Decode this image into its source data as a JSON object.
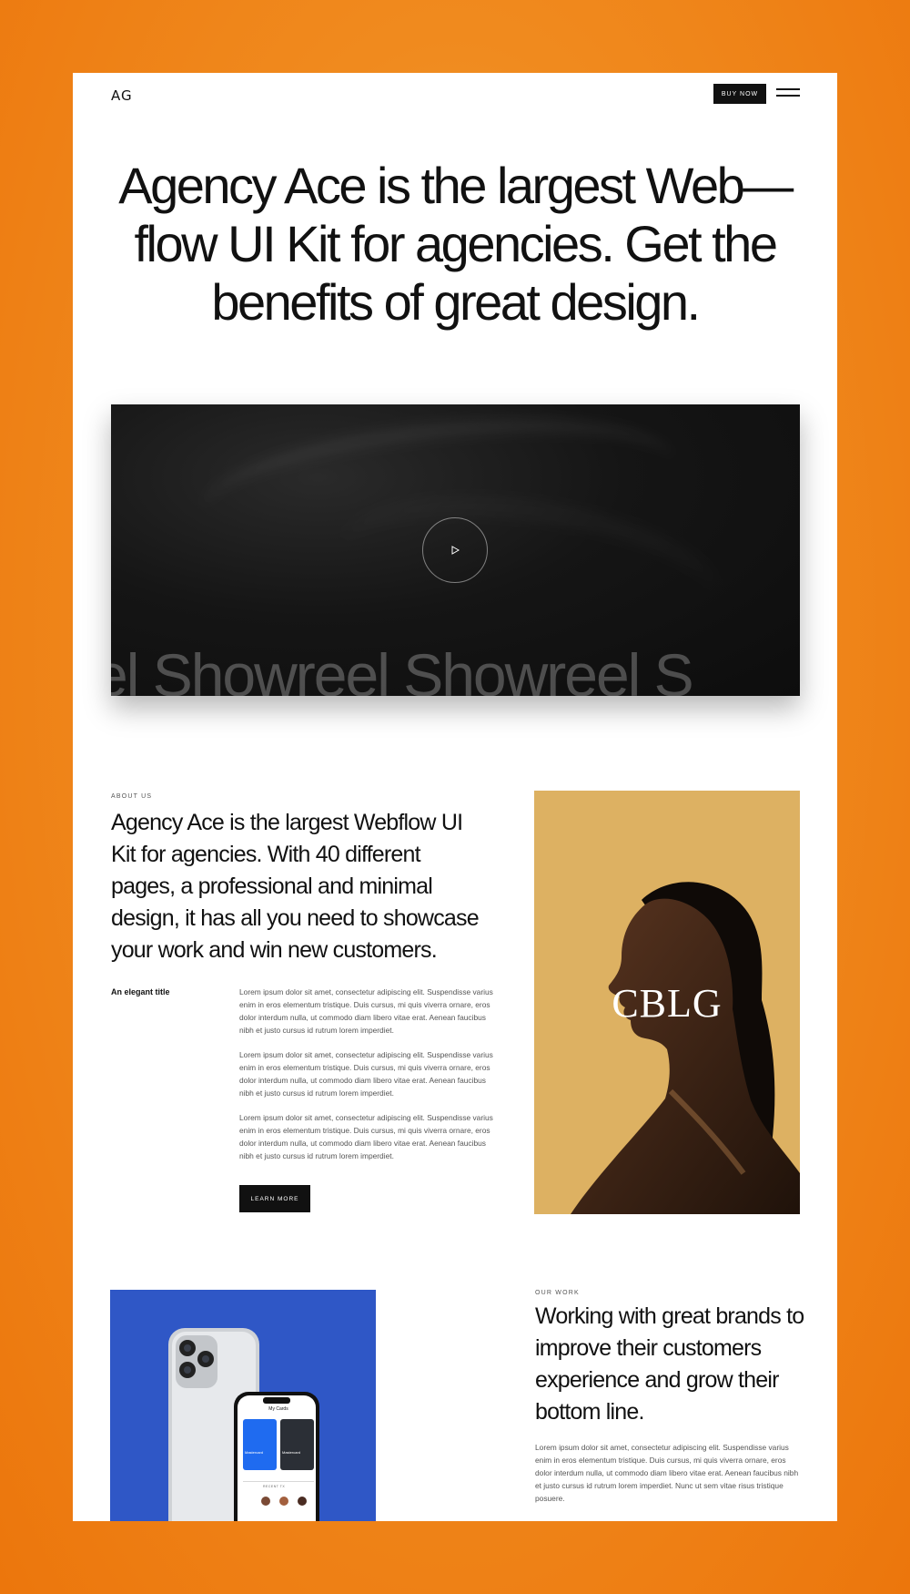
{
  "header": {
    "logo": "AG",
    "buy_now_label": "BUY NOW",
    "menu_icon": "hamburger-menu-icon"
  },
  "hero": {
    "title": "Agency Ace is the largest Web—flow UI Kit for agencies. Get the benefits of great design."
  },
  "video": {
    "marquee_text": "el Showreel Showreel S",
    "play_icon": "play-icon"
  },
  "about": {
    "eyebrow": "ABOUT US",
    "heading": "Agency Ace is the largest Webflow UI Kit for agencies. With 40 different pages, a professional and minimal design, it has all you need to showcase your work and win new customers.",
    "elegant_title": "An elegant title",
    "paragraphs": [
      "Lorem ipsum dolor sit amet, consectetur adipiscing elit. Suspendisse varius enim in eros elementum tristique. Duis cursus, mi quis viverra ornare, eros dolor interdum nulla, ut commodo diam libero vitae erat. Aenean faucibus nibh et justo cursus id rutrum lorem imperdiet.",
      "Lorem ipsum dolor sit amet, consectetur adipiscing elit. Suspendisse varius enim in eros elementum tristique. Duis cursus, mi quis viverra ornare, eros dolor interdum nulla, ut commodo diam libero vitae erat. Aenean faucibus nibh et justo cursus id rutrum lorem imperdiet.",
      "Lorem ipsum dolor sit amet, consectetur adipiscing elit. Suspendisse varius enim in eros elementum tristique. Duis cursus, mi quis viverra ornare, eros dolor interdum nulla, ut commodo diam libero vitae erat. Aenean faucibus nibh et justo cursus id rutrum lorem imperdiet."
    ],
    "learn_more_label": "LEARN MORE",
    "portrait_monogram": "CBLG"
  },
  "work": {
    "eyebrow": "OUR WORK",
    "heading": "Working with great brands to improve their customers experience and grow their bottom line.",
    "paragraph": "Lorem ipsum dolor sit amet, consectetur adipiscing elit. Suspendisse varius enim in eros elementum tristique. Duis cursus, mi quis viverra ornare, eros dolor interdum nulla, ut commodo diam libero vitae erat. Aenean faucibus nibh et justo cursus id rutrum lorem imperdiet. Nunc ut sem vitae risus tristique posuere.",
    "phone_screen": {
      "title": "My Cards",
      "card_labels": [
        "Mastercard",
        "Mastercard"
      ],
      "section_label": "RECENT TX"
    }
  },
  "colors": {
    "background_orange": "#f08a1e",
    "portrait_bg": "#ddb162",
    "phone_bg": "#2f57c6",
    "dark": "#111111"
  }
}
